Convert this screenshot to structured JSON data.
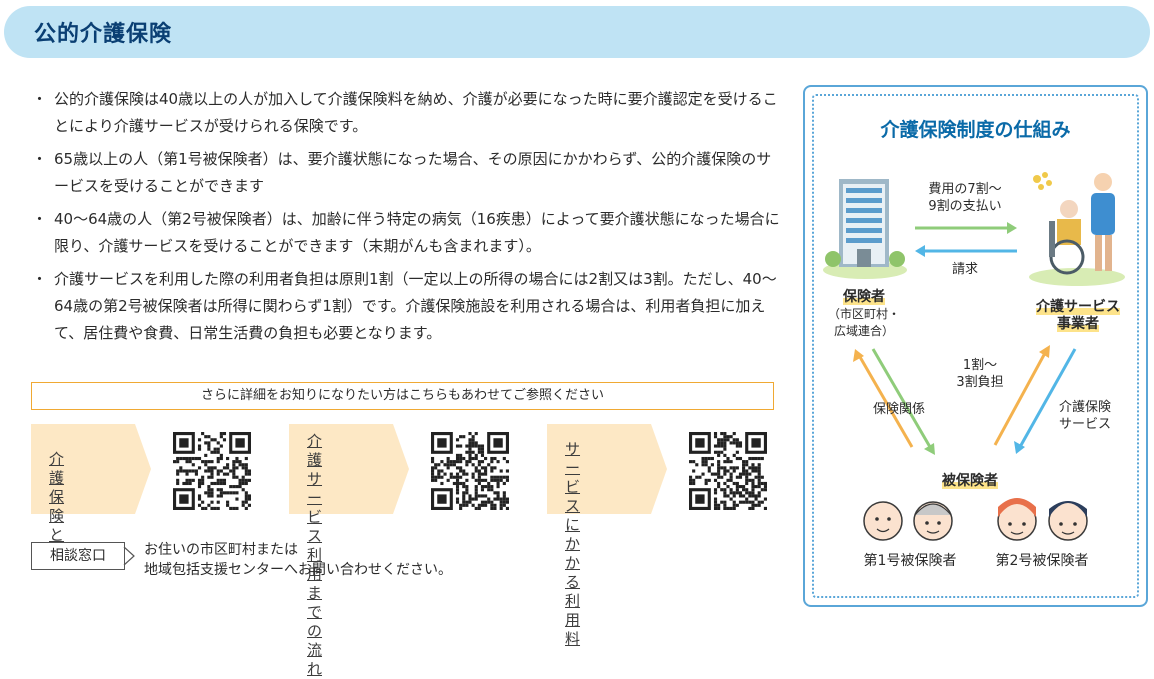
{
  "header": {
    "title": "公的介護保険"
  },
  "bullets": [
    "公的介護保険は40歳以上の人が加入して介護保険料を納め、介護が必要になった時に要介護認定を受けることにより介護サービスが受けられる保険です。",
    "65歳以上の人（第1号被保険者）は、要介護状態になった場合、その原因にかかわらず、公的介護保険のサービスを受けることができます",
    "40〜64歳の人（第2号被保険者）は、加齢に伴う特定の病気（16疾患）によって要介護状態になった場合に限り、介護サービスを受けることができます（末期がんも含まれます）。",
    "介護サービスを利用した際の利用者負担は原則1割（一定以上の所得の場合には2割又は3割。ただし、40〜64歳の第2号被保険者は所得に関わらず1割）です。介護保険施設を利用される場合は、利用者負担に加えて、居住費や食費、日常生活費の負担も必要となります。"
  ],
  "detail_note": "さらに詳細をお知りになりたい方はこちらもあわせてご参照ください",
  "qr_links": [
    {
      "line1": "介護保険",
      "line2": "とは",
      "line3": "",
      "line4": ""
    },
    {
      "line1": "介護",
      "line2": "サービス",
      "line3": "利用までの",
      "line4": "流れ"
    },
    {
      "line1": "サービスに",
      "line2": "かかる",
      "line3": "利用料",
      "line4": ""
    }
  ],
  "consult": {
    "label": "相談窓口",
    "line1": "お住いの市区町村または",
    "line2": "地域包括支援センターへお問い合わせください。"
  },
  "panel": {
    "title": "介護保険制度の仕組み",
    "insurer": "保険者",
    "insurer_sub1": "（市区町村・",
    "insurer_sub2": "広域連合）",
    "provider1": "介護サービス",
    "provider2": "事業者",
    "payment1": "費用の7割〜",
    "payment2": "9割の支払い",
    "claim": "請求",
    "copay1": "1割〜",
    "copay2": "3割負担",
    "relation": "保険関係",
    "service1": "介護保険",
    "service2": "サービス",
    "insured": "被保険者",
    "insured1": "第1号被保険者",
    "insured2": "第2号被保険者"
  },
  "colors": {
    "header_bg": "#bfe3f4",
    "title": "#0a3f73",
    "panel_border": "#5aa6d8",
    "arrow_green": "#8fcc7a",
    "arrow_blue": "#52b6e6",
    "arrow_orange": "#f4b24e",
    "qr_bg": "#fde8c5"
  }
}
